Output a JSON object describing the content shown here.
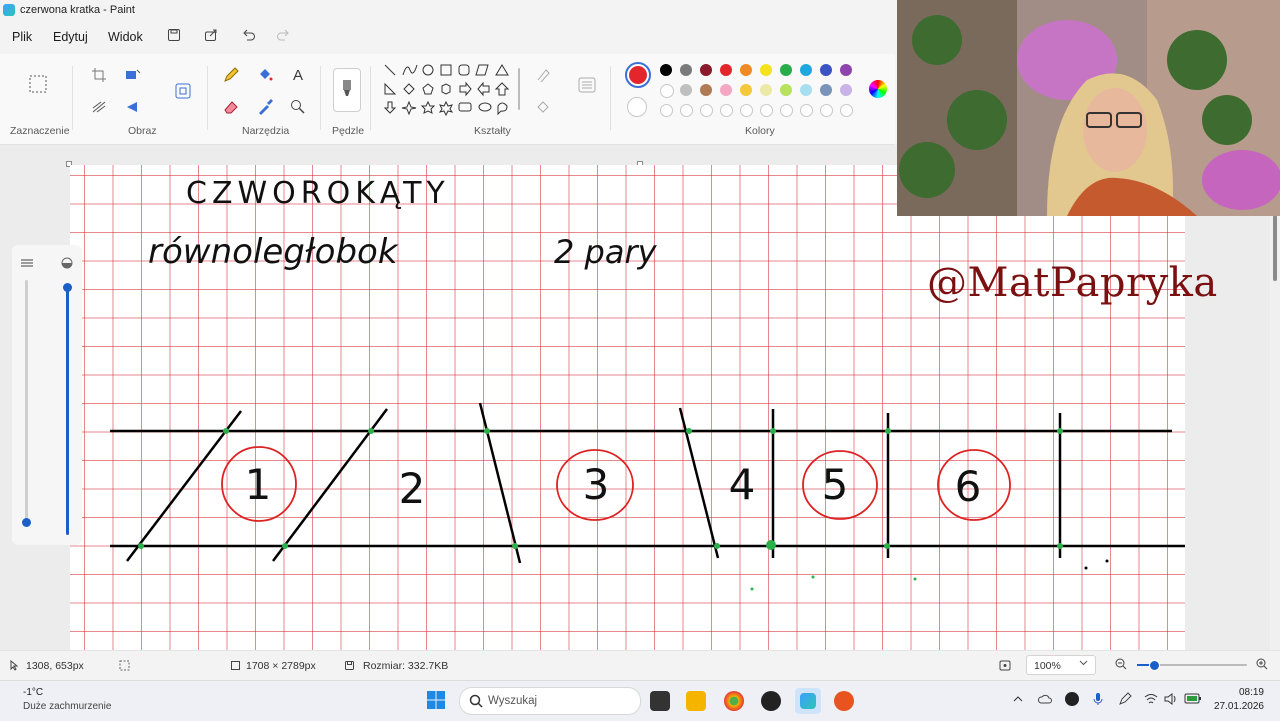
{
  "window": {
    "title": "czerwona kratka - Paint"
  },
  "menu": {
    "file": "Plik",
    "edit": "Edytuj",
    "view": "Widok"
  },
  "ribbon": {
    "groups": {
      "selection": "Zaznaczenie",
      "image": "Obraz",
      "tools": "Narzędzia",
      "brushes": "Pędzle",
      "shapes": "Kształty",
      "colors": "Kolory"
    },
    "colors": {
      "selected_primary": "#e3262b",
      "palette_row1": [
        "#000000",
        "#7a7a7a",
        "#8b1a2b",
        "#e3262b",
        "#f08a24",
        "#f4e21c",
        "#27ad4a",
        "#1ea8de",
        "#3a54c4",
        "#8e44ad"
      ],
      "palette_row2": [
        "#ffffff",
        "#bfbfbf",
        "#b07a54",
        "#f4a6c2",
        "#f5c83c",
        "#ece8a6",
        "#b6e25c",
        "#a8dff0",
        "#7a93b8",
        "#c8b2e6"
      ]
    }
  },
  "drawing": {
    "heading": "CZWOROKĄTY",
    "line2_left": "równoległobok",
    "line2_right": "2 pary",
    "numbers": [
      "1",
      "2",
      "3",
      "4",
      "5",
      "6"
    ]
  },
  "watermark": "@MatPapryka",
  "status": {
    "cursor": "1308, 653px",
    "canvas_size": "1708 × 2789px",
    "file_size": "Rozmiar: 332.7KB",
    "zoom": "100%"
  },
  "taskbar": {
    "weather_temp": "-1°C",
    "weather_desc": "Duże zachmurzenie",
    "search_placeholder": "Wyszukaj",
    "time": "08:19",
    "date": "27.01.2026"
  }
}
